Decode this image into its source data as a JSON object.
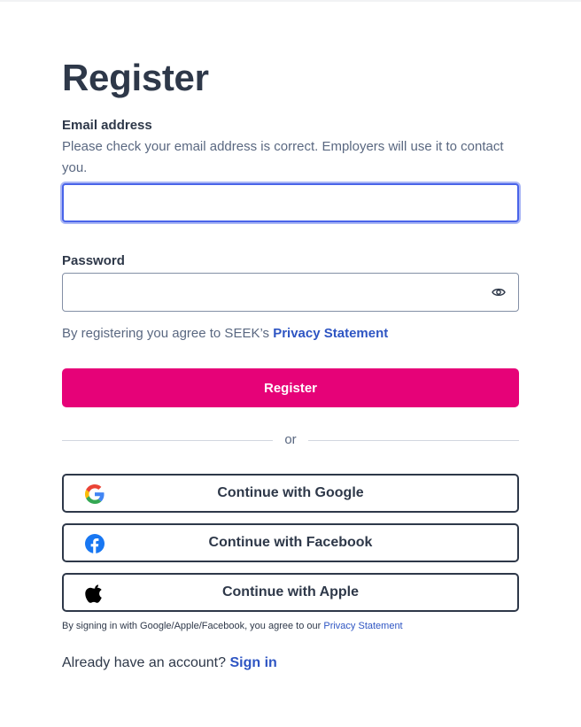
{
  "form": {
    "title": "Register",
    "email": {
      "label": "Email address",
      "help": "Please check your email address is correct. Employers will use it to contact you.",
      "value": "",
      "placeholder": ""
    },
    "password": {
      "label": "Password",
      "value": "",
      "placeholder": ""
    },
    "agreement": {
      "text": "By registering you agree to SEEK’s ",
      "link": "Privacy Statement"
    },
    "register_button": "Register",
    "divider_text": "or",
    "social": {
      "google": "Continue with Google",
      "facebook": "Continue with Facebook",
      "apple": "Continue with Apple"
    },
    "social_note": {
      "text": "By signing in with Google/Apple/Facebook, you agree to our ",
      "link": "Privacy Statement"
    },
    "signin": {
      "text": "Already have an account? ",
      "link": "Sign in"
    }
  },
  "colors": {
    "accent": "#e60278",
    "link": "#2e55c3",
    "text": "#2e3849",
    "muted": "#5a6881",
    "focus_ring": "#a9b6f5"
  },
  "icons": [
    "eye-icon",
    "google-icon",
    "facebook-icon",
    "apple-icon"
  ]
}
